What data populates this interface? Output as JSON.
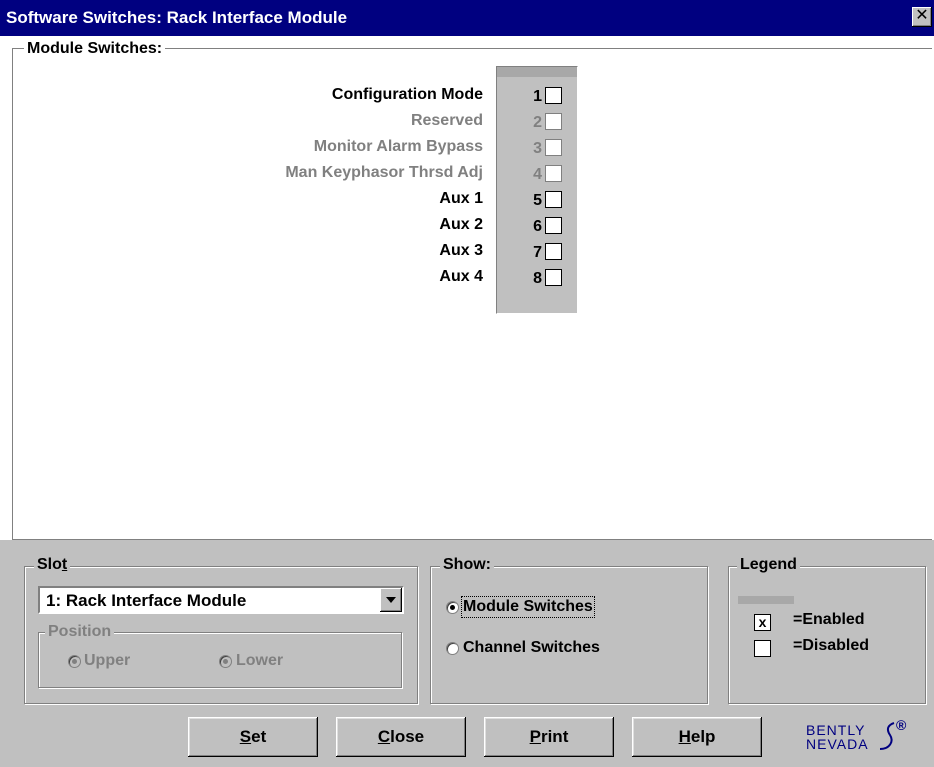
{
  "window": {
    "title": "Software Switches: Rack Interface Module",
    "close_glyph": "✕"
  },
  "module_switches": {
    "title": "Module Switches:",
    "switches": [
      {
        "label": "Configuration Mode",
        "number": "1",
        "enabled": true,
        "checked": false
      },
      {
        "label": "Reserved",
        "number": "2",
        "enabled": false,
        "checked": false
      },
      {
        "label": "Monitor Alarm Bypass",
        "number": "3",
        "enabled": false,
        "checked": false
      },
      {
        "label": "Man Keyphasor Thrsd Adj",
        "number": "4",
        "enabled": false,
        "checked": false
      },
      {
        "label": "Aux 1",
        "number": "5",
        "enabled": true,
        "checked": false
      },
      {
        "label": "Aux 2",
        "number": "6",
        "enabled": true,
        "checked": false
      },
      {
        "label": "Aux 3",
        "number": "7",
        "enabled": true,
        "checked": false
      },
      {
        "label": "Aux 4",
        "number": "8",
        "enabled": true,
        "checked": false
      }
    ]
  },
  "slot": {
    "title_pre": "Slo",
    "title_mnemonic": "t",
    "selected": "1: Rack Interface Module",
    "position": {
      "title": "Position",
      "options": [
        {
          "label": "Upper",
          "selected": true,
          "enabled": false
        },
        {
          "label": "Lower",
          "selected": true,
          "enabled": false
        }
      ]
    }
  },
  "show": {
    "title": "Show:",
    "options": [
      {
        "label": "Module Switches",
        "selected": true
      },
      {
        "label": "Channel Switches",
        "selected": false
      }
    ]
  },
  "legend": {
    "title": "Legend",
    "enabled_label": "=Enabled",
    "disabled_label": "=Disabled",
    "enabled_mark": "x"
  },
  "buttons": {
    "set": {
      "mnemonic": "S",
      "rest": "et"
    },
    "close": {
      "mnemonic": "C",
      "rest": "lose"
    },
    "print": {
      "mnemonic": "P",
      "rest": "rint"
    },
    "help": {
      "mnemonic": "H",
      "rest": "elp"
    }
  },
  "logo": {
    "line1": "BENTLY",
    "line2": "NEVADA",
    "mark": "®"
  },
  "colors": {
    "title_bar": "#000080",
    "face": "#c0c0c0",
    "disabled_text": "#808080"
  }
}
